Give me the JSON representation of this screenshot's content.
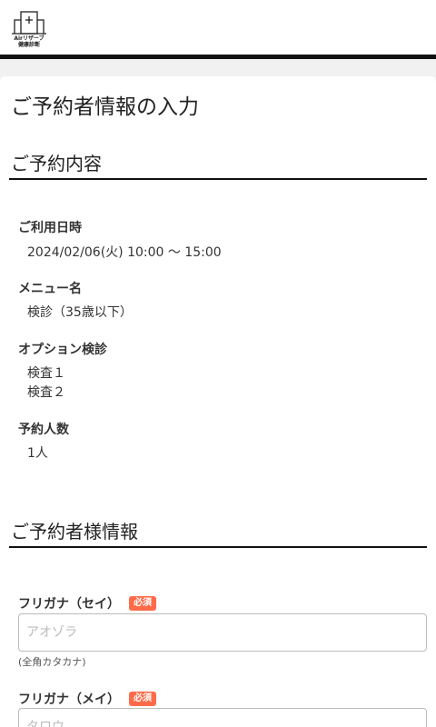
{
  "header": {
    "logo_line1": "Airリザーブ",
    "logo_line2": "健康診断"
  },
  "page_title": "ご予約者情報の入力",
  "reservation": {
    "section_title": "ご予約内容",
    "datetime_label": "ご利用日時",
    "datetime_value": "2024/02/06(火) 10:00 〜 15:00",
    "menu_label": "メニュー名",
    "menu_value": "検診（35歳以下）",
    "option_label": "オプション検診",
    "options": [
      "検査１",
      "検査２"
    ],
    "people_label": "予約人数",
    "people_value": "1人"
  },
  "booker": {
    "section_title": "ご予約者様情報",
    "furigana_sei": {
      "label": "フリガナ（セイ）",
      "badge": "必須",
      "placeholder": "アオゾラ",
      "hint": "(全角カタカナ)"
    },
    "furigana_mei": {
      "label": "フリガナ（メイ）",
      "badge": "必須",
      "placeholder": "タロウ"
    }
  }
}
